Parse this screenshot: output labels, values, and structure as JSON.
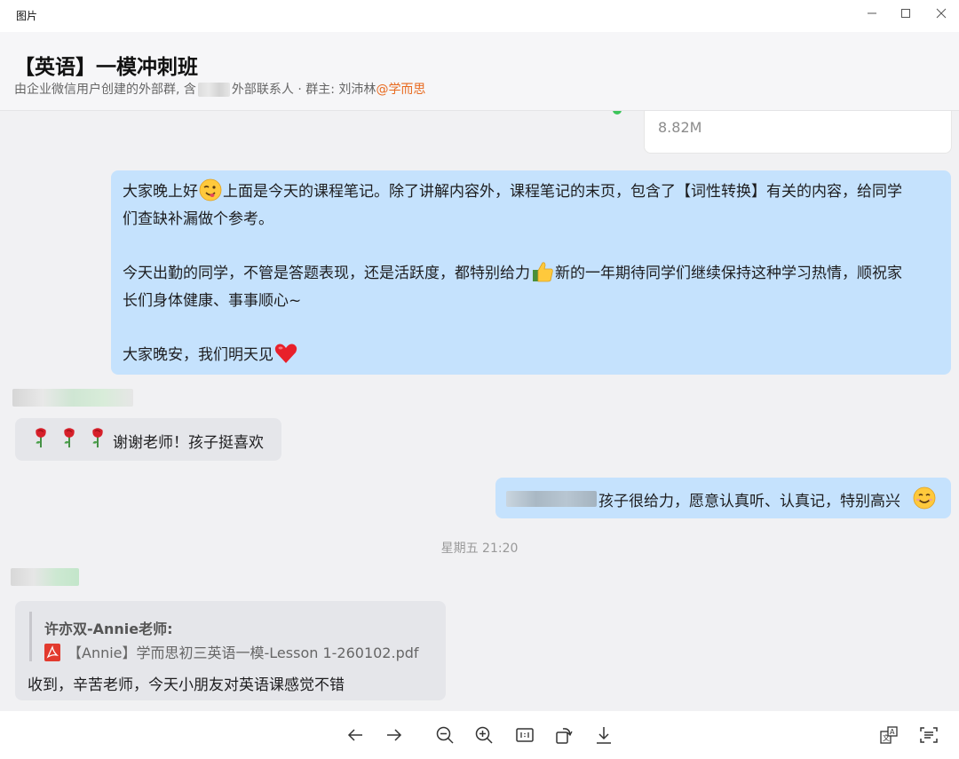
{
  "window": {
    "title": "图片"
  },
  "header": {
    "group_name": "【英语】一模冲刺班",
    "desc_prefix": "由企业微信用户创建的外部群, 含",
    "desc_suffix": "外部联系人 · 群主: 刘沛林",
    "owner_org": "@学而思"
  },
  "file_card": {
    "size": "8.82M"
  },
  "messages": {
    "teacher_note": {
      "line1_a": "大家晚上好",
      "line1_b": "上面是今天的课程笔记。除了讲解内容外，课程笔记的末页，包含了【词性转换】有关的内容，给同学",
      "line2": "们查缺补漏做个参考。",
      "line3_a": "今天出勤的同学，不管是答题表现，还是活跃度，都特别给力",
      "line3_b": "新的一年期待同学们继续保持这种学习热情，顺祝家",
      "line4": "长们身体健康、事事顺心~",
      "line5": "大家晚安，我们明天见"
    },
    "parent_thanks": {
      "text": "谢谢老师！孩子挺喜欢"
    },
    "teacher_reply": {
      "text": "孩子很给力，愿意认真听、认真记，特别高兴"
    },
    "timestamp": "星期五 21:20",
    "quote_reply": {
      "quoted_name": "许亦双-Annie老师:",
      "quoted_file": "【Annie】学而思初三英语一模-Lesson 1-260102.pdf",
      "text": "收到，辛苦老师，今天小朋友对英语课感觉不错"
    }
  },
  "toolbar": {
    "icons": [
      "previous-icon",
      "next-icon",
      "zoom-out-icon",
      "zoom-in-icon",
      "actual-size-icon",
      "rotate-icon",
      "download-icon",
      "translate-icon",
      "text-extract-icon"
    ]
  },
  "colors": {
    "self_bubble": "#c5e2fd",
    "other_bubble": "#e5e6ea",
    "org_accent": "#e86a1f"
  }
}
